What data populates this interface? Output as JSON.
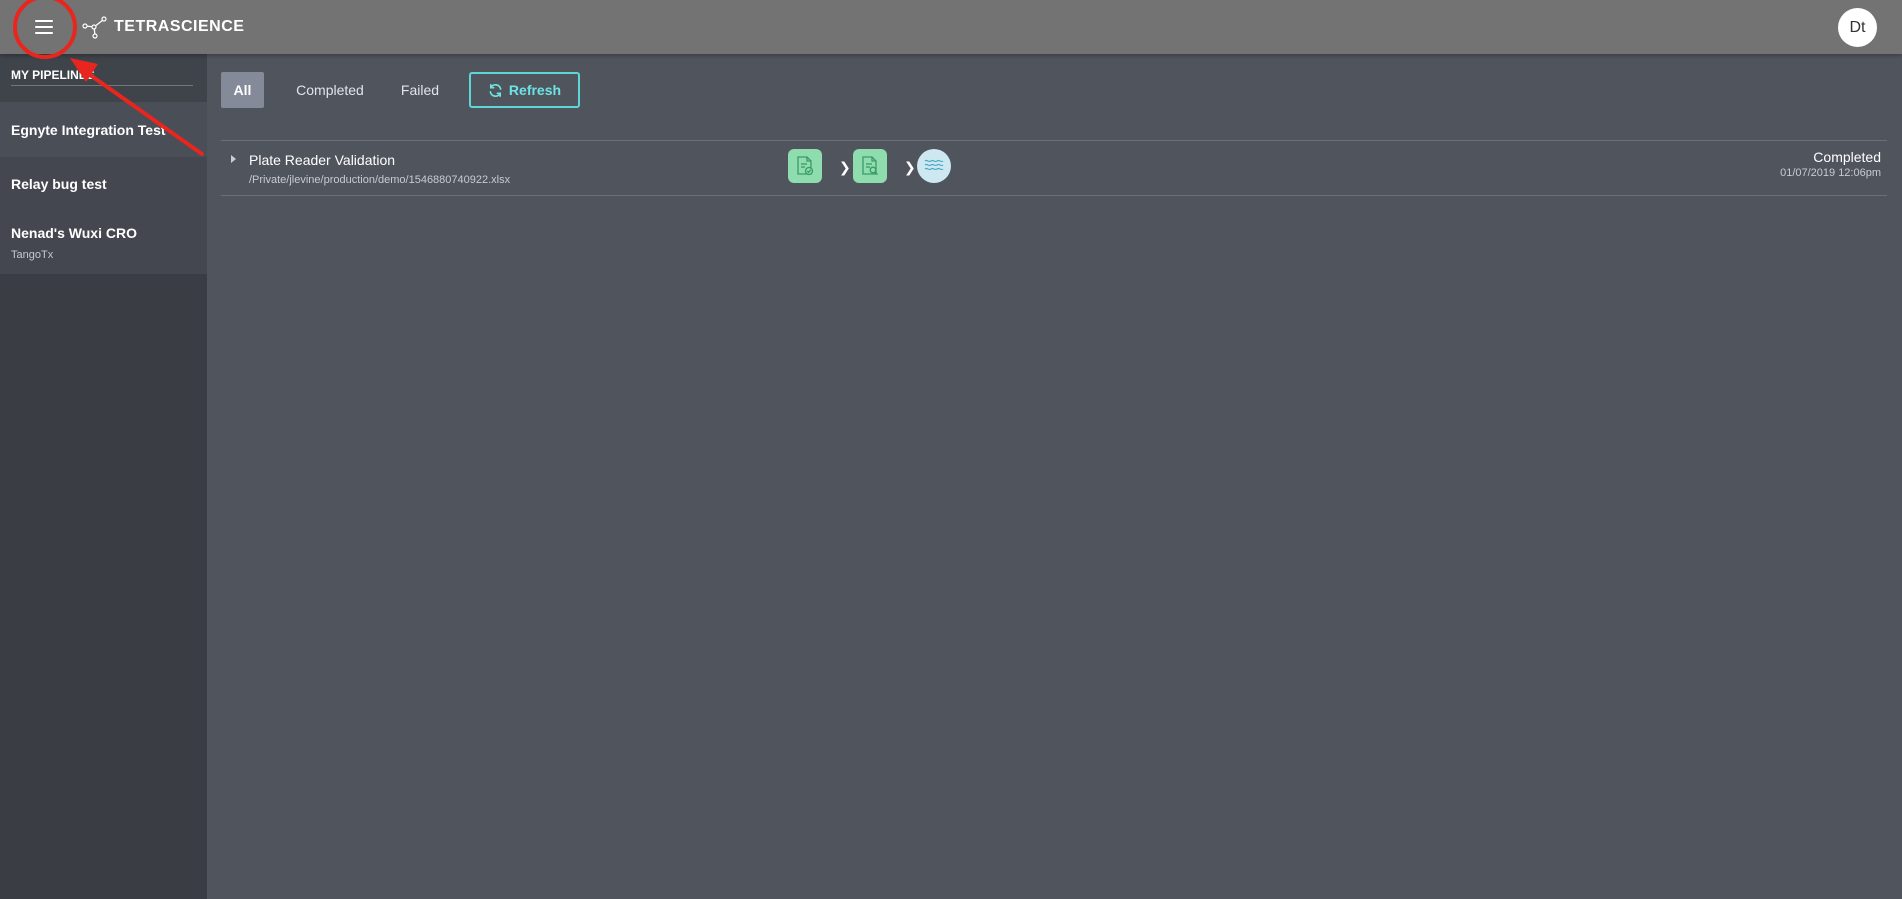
{
  "header": {
    "brand": "TETRASCIENCE",
    "user_initials": "Dt"
  },
  "sidebar": {
    "title": "MY PIPELINES",
    "items": [
      {
        "name": "Egnyte Integration Test",
        "sub": ""
      },
      {
        "name": "Relay bug test",
        "sub": ""
      },
      {
        "name": "Nenad's Wuxi CRO",
        "sub": "TangoTx"
      }
    ]
  },
  "filters": {
    "all": "All",
    "completed": "Completed",
    "failed": "Failed",
    "refresh": "Refresh"
  },
  "runs": [
    {
      "title": "Plate Reader Validation",
      "path": "/Private/jlevine/production/demo/1546880740922.xlsx",
      "status": "Completed",
      "timestamp": "01/07/2019 12:06pm"
    }
  ],
  "colors": {
    "accent": "#5ed6d8",
    "step_green": "#8fdcae",
    "annotation": "#e8261e"
  },
  "icons": [
    "menu-icon",
    "tetrascience-logo-icon",
    "refresh-icon",
    "expand-icon",
    "file-check-icon",
    "file-search-icon",
    "waves-icon",
    "chevron-right-icon"
  ]
}
